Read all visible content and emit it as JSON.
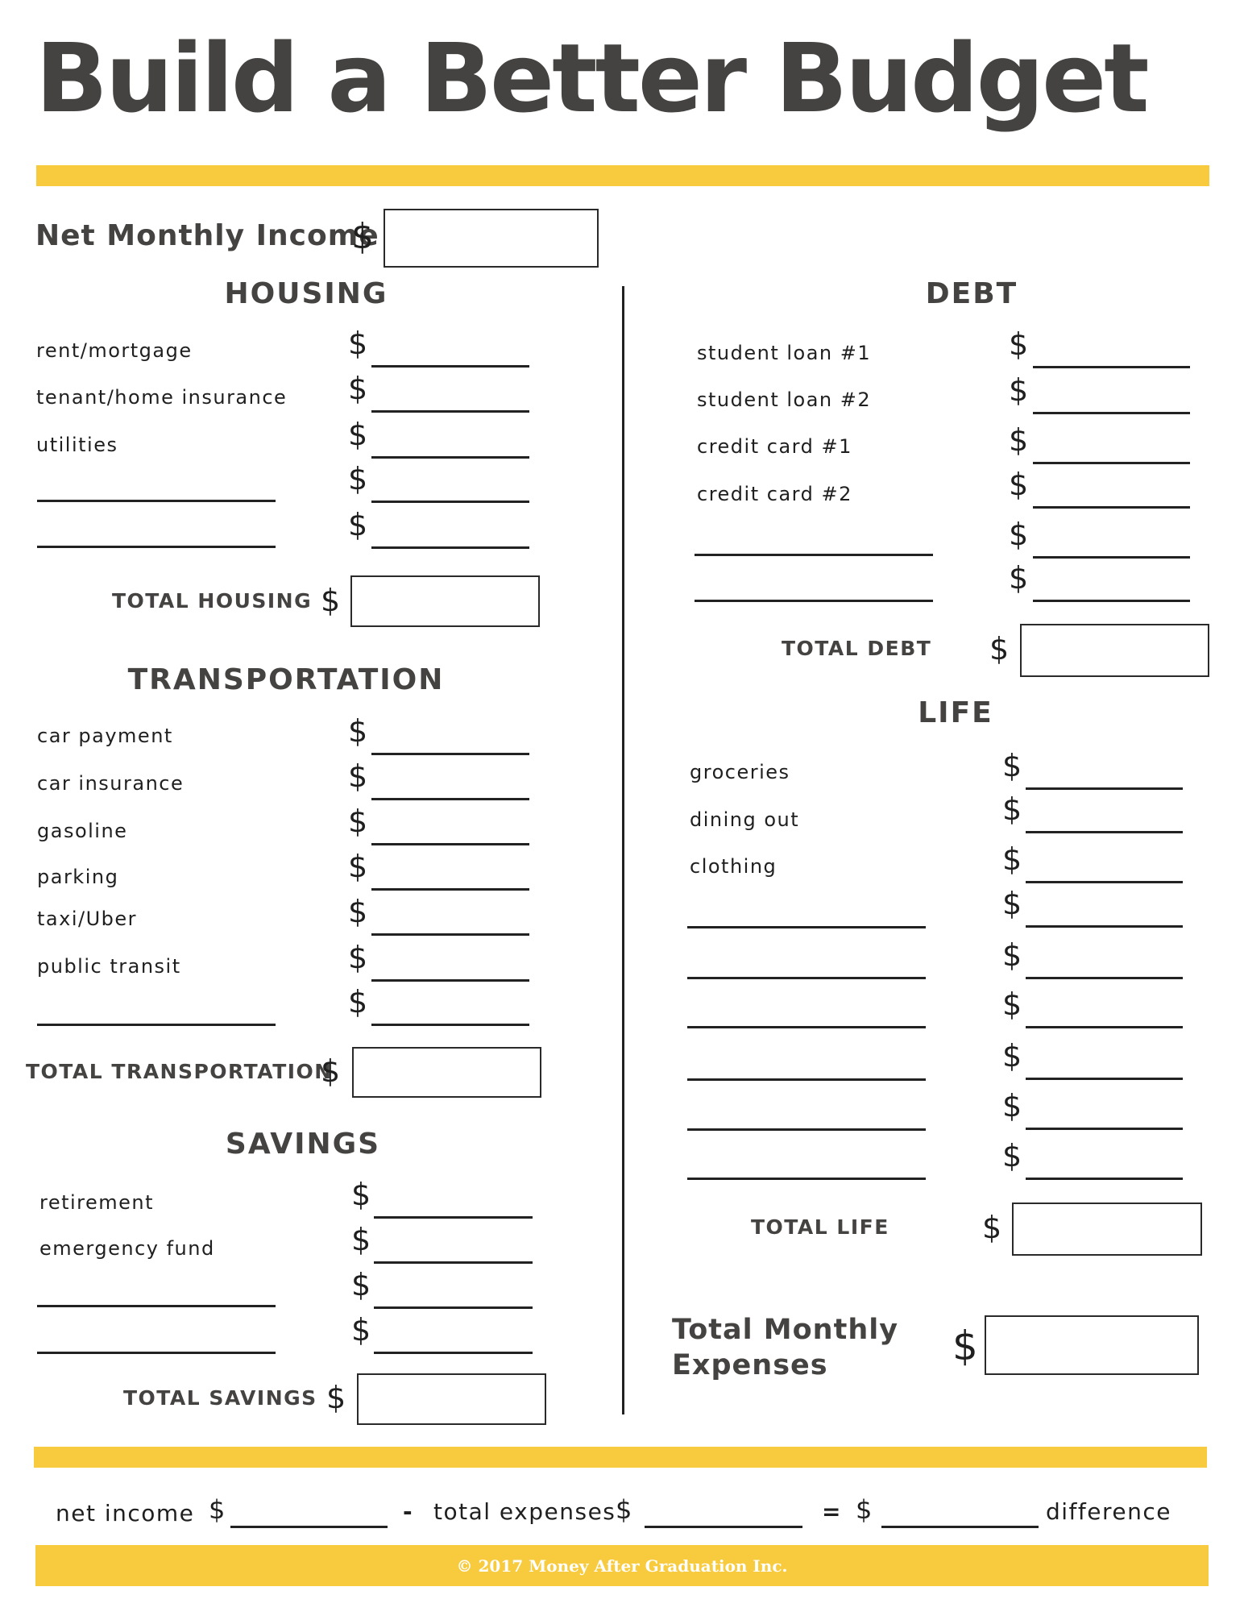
{
  "title": "Build a Better Budget",
  "brand_color": "#F7CB3D",
  "currency_symbol": "$",
  "net_monthly_income": {
    "label": "Net Monthly Income",
    "value": ""
  },
  "housing": {
    "heading": "HOUSING",
    "items": [
      "rent/mortgage",
      "tenant/home insurance",
      "utilities",
      "",
      ""
    ],
    "total_label": "TOTAL HOUSING"
  },
  "transportation": {
    "heading": "TRANSPORTATION",
    "items": [
      "car payment",
      "car insurance",
      "gasoline",
      "parking",
      "taxi/Uber",
      "public transit",
      ""
    ],
    "total_label": "TOTAL TRANSPORTATION"
  },
  "savings": {
    "heading": "SAVINGS",
    "items": [
      "retirement",
      "emergency fund",
      "",
      ""
    ],
    "total_label": "TOTAL SAVINGS"
  },
  "debt": {
    "heading": "DEBT",
    "items": [
      "student loan #1",
      "student loan #2",
      "credit card #1",
      "credit card #2",
      "",
      ""
    ],
    "total_label": "TOTAL DEBT"
  },
  "life": {
    "heading": "LIFE",
    "items": [
      "groceries",
      "dining out",
      "clothing",
      "",
      "",
      "",
      "",
      "",
      ""
    ],
    "total_label": "TOTAL LIFE"
  },
  "total_monthly_expenses": {
    "line1": "Total Monthly",
    "line2": "Expenses"
  },
  "equation": {
    "net_income": "net income",
    "minus": "-",
    "total_expenses": "total expenses",
    "equals": "=",
    "difference": "difference"
  },
  "footer": "© 2017 Money After Graduation Inc."
}
